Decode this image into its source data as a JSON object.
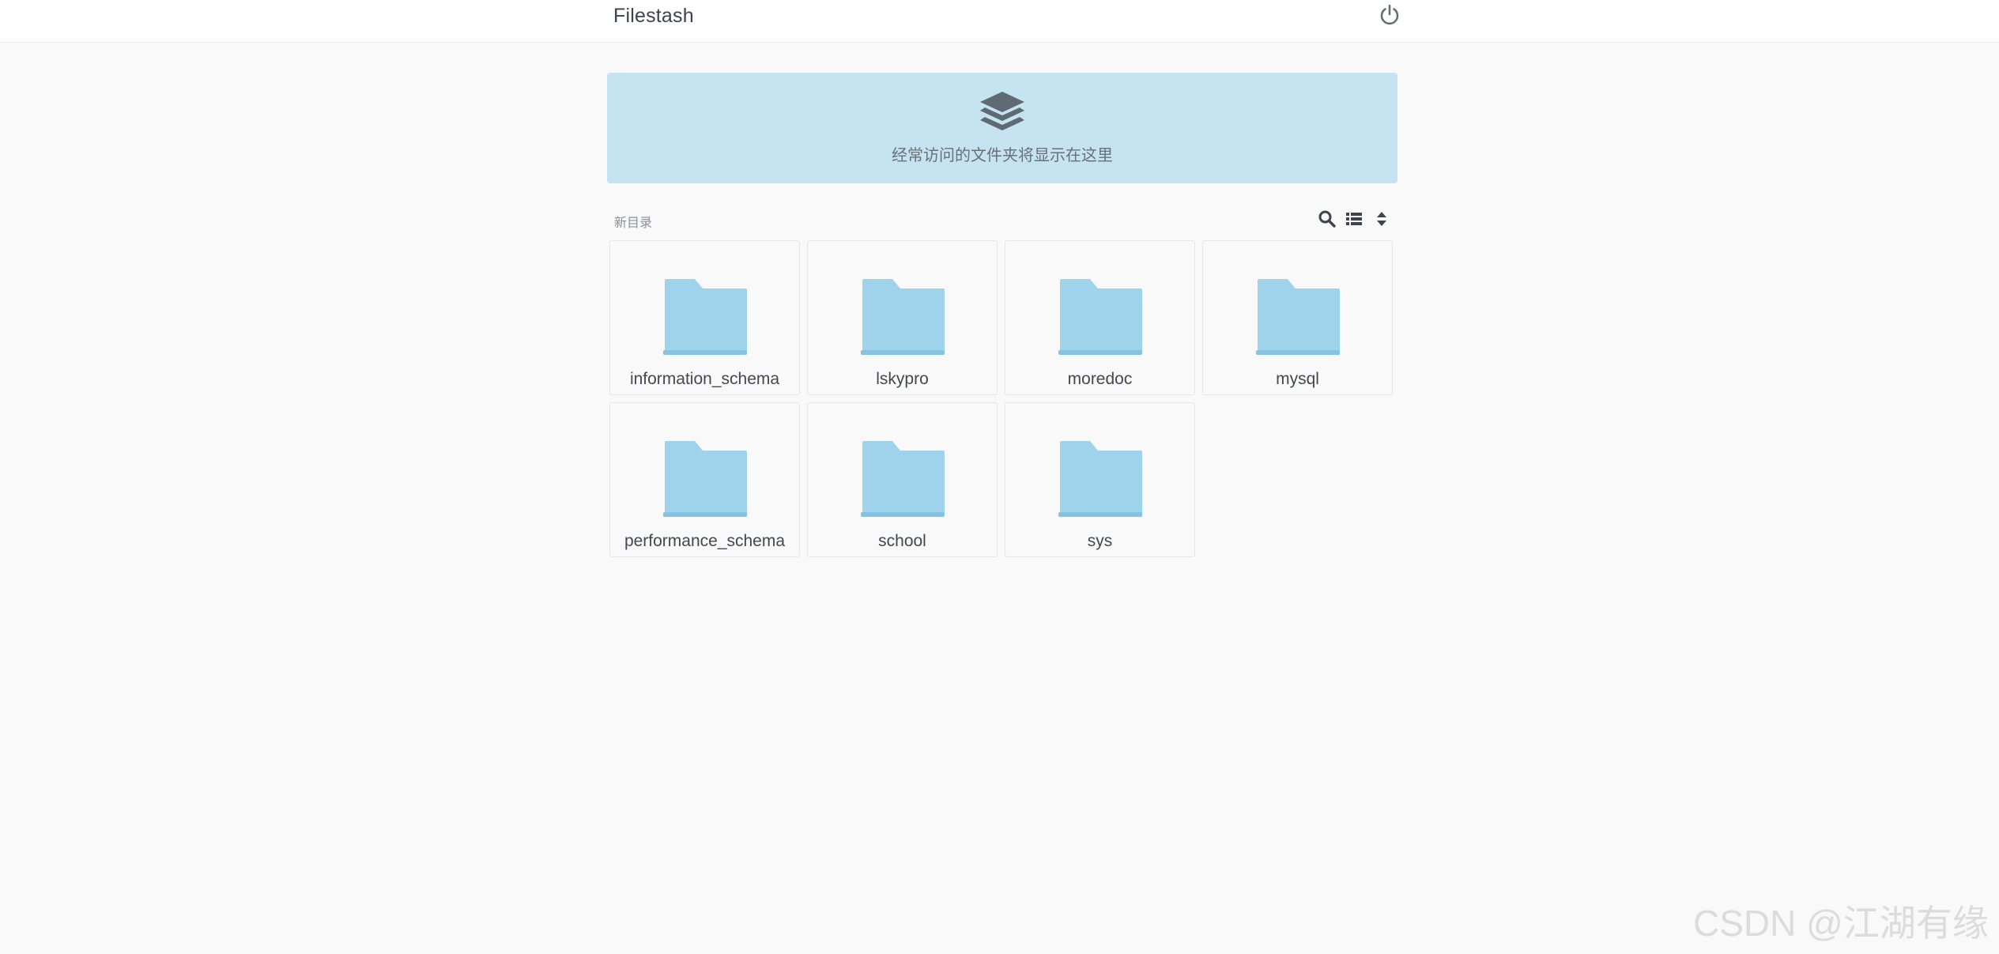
{
  "app": {
    "brand": "Filestash"
  },
  "banner": {
    "icon": "layers-icon",
    "message": "经常访问的文件夹将显示在这里"
  },
  "toolbar": {
    "label": "新目录",
    "icons": [
      "search-icon",
      "list-view-icon",
      "sort-icon"
    ]
  },
  "folders": [
    {
      "name": "information_schema",
      "icon": "folder-icon"
    },
    {
      "name": "lskypro",
      "icon": "folder-icon"
    },
    {
      "name": "moredoc",
      "icon": "folder-icon"
    },
    {
      "name": "mysql",
      "icon": "folder-icon"
    },
    {
      "name": "performance_schema",
      "icon": "folder-icon"
    },
    {
      "name": "school",
      "icon": "folder-icon"
    },
    {
      "name": "sys",
      "icon": "folder-icon"
    }
  ],
  "watermark": "CSDN @江湖有缘",
  "colors": {
    "background": "#f9f9f9",
    "banner": "#c5e3f1",
    "folder": "#9fd3ec",
    "folder_tab": "#8fcbe6",
    "icon_gray": "#5f6a73"
  }
}
